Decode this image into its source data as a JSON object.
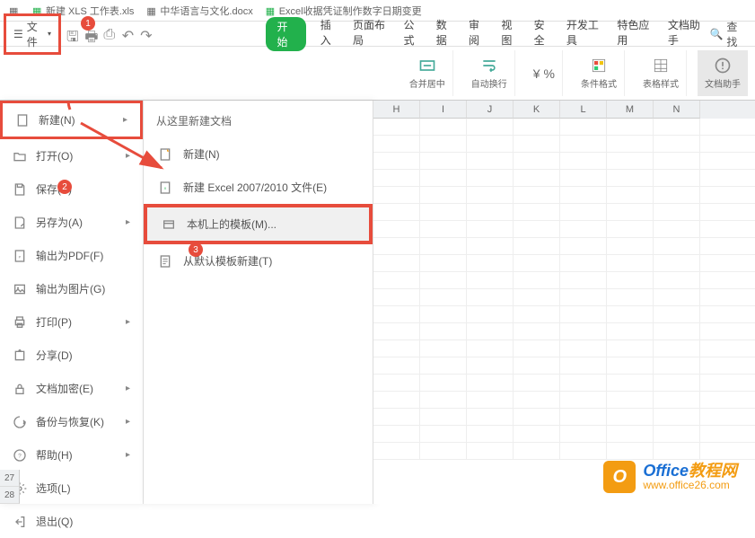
{
  "topbar": {
    "tabs": [
      "",
      "新建 XLS 工作表.xls",
      "",
      "中华语言与文化.docx",
      "",
      "Excel收据凭证制作数字日期变更",
      ""
    ]
  },
  "qat": {
    "file_label": "文件",
    "find_label": "查找"
  },
  "ribbon_tabs": {
    "start": "开始",
    "insert": "插入",
    "layout": "页面布局",
    "formula": "公式",
    "data": "数据",
    "review": "审阅",
    "view": "视图",
    "security": "安全",
    "dev": "开发工具",
    "special": "特色应用",
    "doc_helper": "文档助手"
  },
  "ribbon": {
    "merge": "合并居中",
    "wrap": "自动换行",
    "cond_fmt": "条件格式",
    "table_style": "表格样式",
    "helper": "文档助手"
  },
  "file_menu": {
    "new": "新建(N)",
    "open": "打开(O)",
    "save": "保存(S)",
    "save_as": "另存为(A)",
    "export_pdf": "输出为PDF(F)",
    "export_img": "输出为图片(G)",
    "print": "打印(P)",
    "share": "分享(D)",
    "encrypt": "文档加密(E)",
    "backup": "备份与恢复(K)",
    "help": "帮助(H)",
    "options": "选项(L)",
    "exit": "退出(Q)"
  },
  "submenu": {
    "head": "从这里新建文档",
    "new": "新建(N)",
    "xls": "新建 Excel 2007/2010 文件(E)",
    "template": "本机上的模板(M)...",
    "default_tpl": "从默认模板新建(T)"
  },
  "columns": [
    "H",
    "I",
    "J",
    "K",
    "L",
    "M",
    "N"
  ],
  "rownums": [
    "27",
    "28"
  ],
  "badges": {
    "b1": "1",
    "b2": "2",
    "b3": "3"
  },
  "watermark": {
    "logo": "O",
    "main_a": "Office",
    "main_b": "教程网",
    "sub": "www.office26.com"
  }
}
